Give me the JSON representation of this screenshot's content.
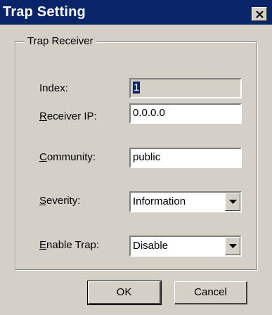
{
  "window": {
    "title": "Trap Setting"
  },
  "group": {
    "legend": "Trap Receiver"
  },
  "fields": {
    "index": {
      "label": "Index:",
      "value": "1"
    },
    "receiver_ip": {
      "label_hotkey": "R",
      "label_rest": "eceiver IP:",
      "value": "0.0.0.0"
    },
    "community": {
      "label_hotkey": "C",
      "label_rest": "ommunity:",
      "value": "public"
    },
    "severity": {
      "label_hotkey": "S",
      "label_rest": "everity:",
      "value": "Information"
    },
    "enable_trap": {
      "label_hotkey": "E",
      "label_rest": "nable Trap:",
      "value": "Disable"
    }
  },
  "buttons": {
    "ok": "OK",
    "cancel": "Cancel"
  },
  "icons": {
    "close": "close-icon",
    "dropdown": "chevron-down-icon"
  },
  "colors": {
    "titlebar": "#0a246a",
    "face": "#d4d0c8"
  }
}
